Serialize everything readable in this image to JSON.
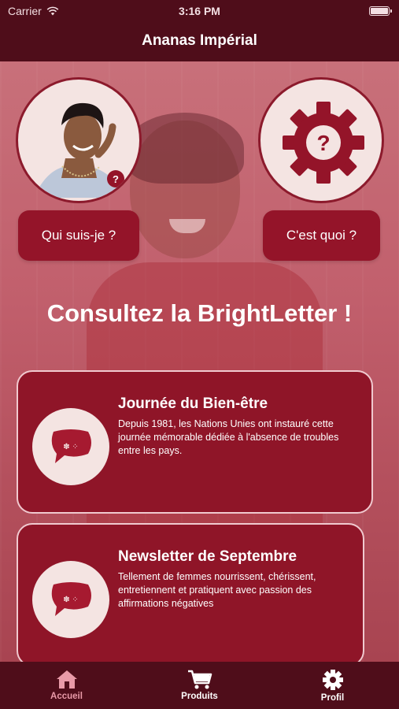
{
  "status_bar": {
    "carrier": "Carrier",
    "time": "3:16 PM"
  },
  "nav": {
    "title": "Ananas Impérial"
  },
  "buttons": {
    "about_label": "Qui suis-je ?",
    "what_label": "C'est quoi ?"
  },
  "headline": "Consultez la BrightLetter !",
  "cards": [
    {
      "title": "Journée du Bien-être",
      "text": "Depuis 1981, les Nations Unies ont instauré cette journée mémorable dédiée à l'absence de troubles entre les pays."
    },
    {
      "title": "Newsletter de Septembre",
      "text": "Tellement de femmes nourrissent, chérissent, entretiennent et pratiquent avec passion des affirmations négatives"
    }
  ],
  "tabs": [
    {
      "label": "Accueil",
      "icon": "home-icon",
      "active": true
    },
    {
      "label": "Produits",
      "icon": "cart-icon",
      "active": false
    },
    {
      "label": "Profil",
      "icon": "gear-icon",
      "active": false
    }
  ],
  "colors": {
    "primary": "#941429",
    "dark": "#4f0d1a",
    "light": "#f4e4e2",
    "active_tab": "#e99aa8"
  }
}
